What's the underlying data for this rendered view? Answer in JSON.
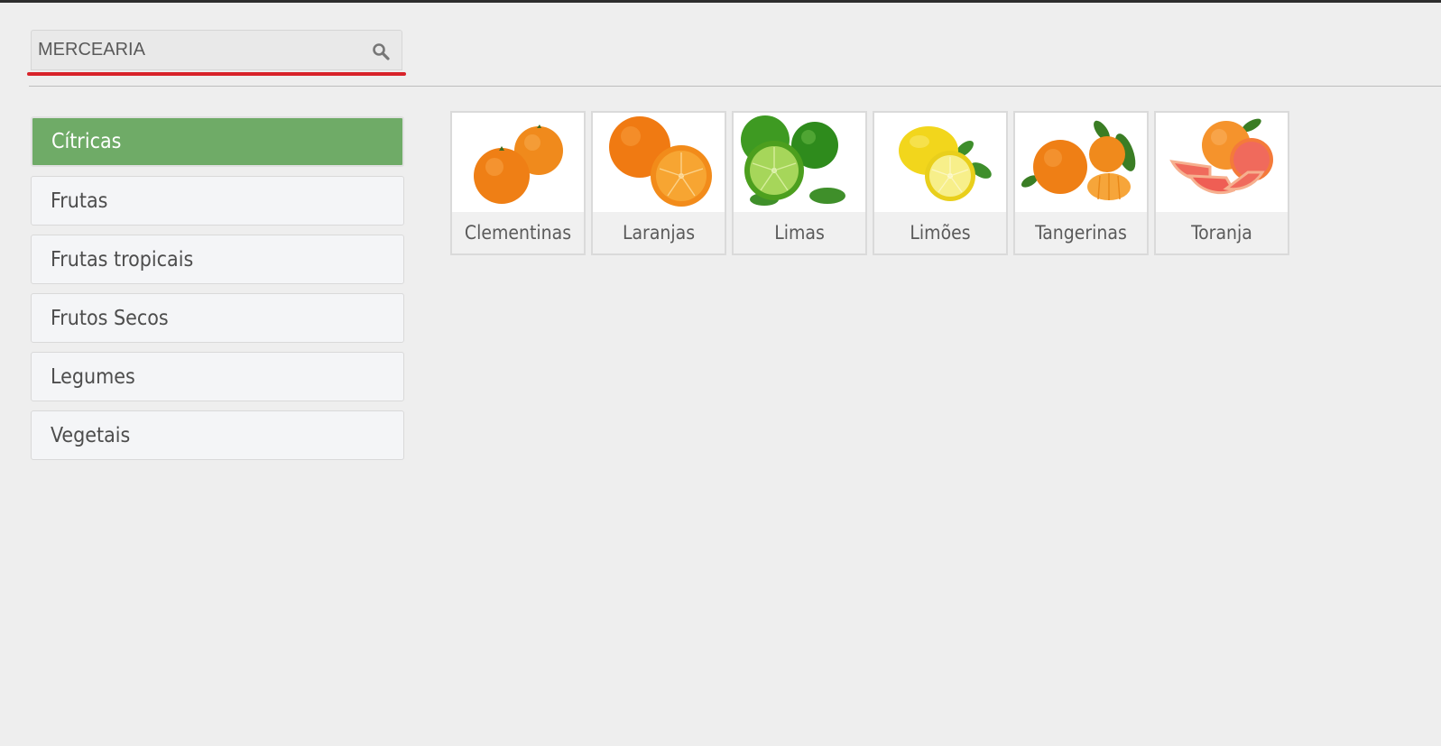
{
  "search": {
    "value": "MERCEARIA"
  },
  "categories": [
    {
      "label": "Cítricas",
      "active": true
    },
    {
      "label": "Frutas",
      "active": false
    },
    {
      "label": "Frutas tropicais",
      "active": false
    },
    {
      "label": "Frutos Secos",
      "active": false
    },
    {
      "label": "Legumes",
      "active": false
    },
    {
      "label": "Vegetais",
      "active": false
    }
  ],
  "products": [
    {
      "label": "Clementinas",
      "icon": "clementine-image"
    },
    {
      "label": "Laranjas",
      "icon": "orange-image"
    },
    {
      "label": "Limas",
      "icon": "lime-image"
    },
    {
      "label": "Limões",
      "icon": "lemon-image"
    },
    {
      "label": "Tangerinas",
      "icon": "tangerine-image"
    },
    {
      "label": "Toranja",
      "icon": "grapefruit-image"
    }
  ],
  "colors": {
    "active_category": "#6fab67",
    "search_underline": "#d8232a",
    "background": "#eeeeee"
  }
}
